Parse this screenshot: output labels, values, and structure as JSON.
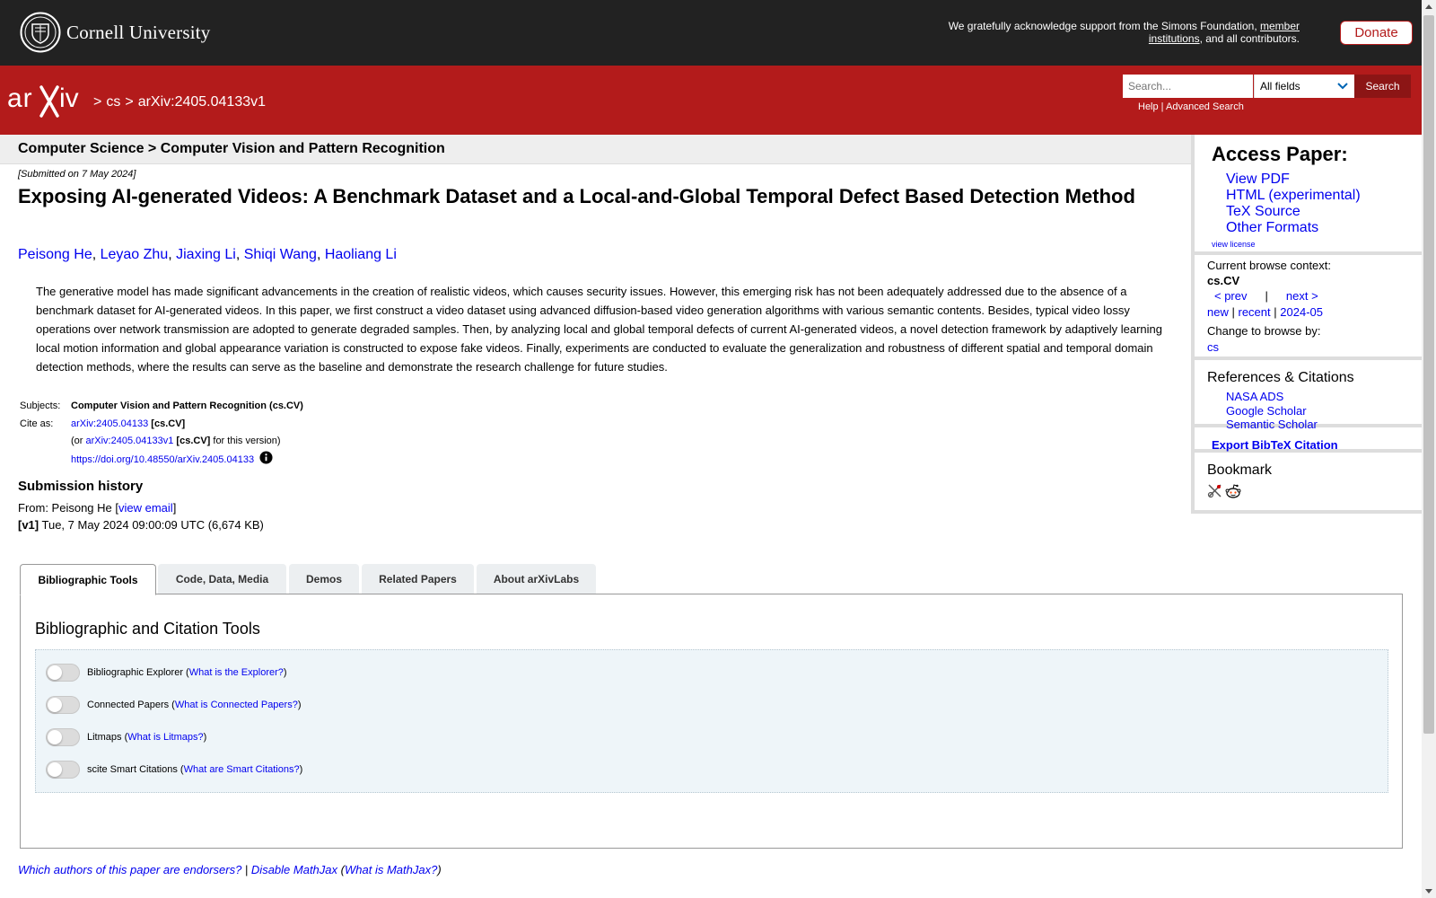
{
  "header": {
    "university": "Cornell University",
    "support_text_1": "We gratefully acknowledge support from the Simons Foundation, ",
    "support_link_1": "member institutions",
    "support_text_2": ", and all contributors.",
    "donate_label": "Donate"
  },
  "arxiv_bar": {
    "crumbs": [
      ">",
      "cs",
      ">",
      "arXiv:2405.04133v1"
    ],
    "search_placeholder": "Search...",
    "field_select": "All fields",
    "search_button": "Search",
    "help": "Help",
    "help_sep": " | ",
    "advanced_search": "Advanced Search"
  },
  "subheader": "Computer Science > Computer Vision and Pattern Recognition",
  "submitted": "[Submitted on 7 May 2024]",
  "title": "Exposing AI-generated Videos: A Benchmark Dataset and a Local-and-Global Temporal Defect Based Detection Method",
  "authors": [
    "Peisong He",
    "Leyao Zhu",
    "Jiaxing Li",
    "Shiqi Wang",
    "Haoliang Li"
  ],
  "abstract": "The generative model has made significant advancements in the creation of realistic videos, which causes security issues. However, this emerging risk has not been adequately addressed due to the absence of a benchmark dataset for AI-generated videos. In this paper, we first construct a video dataset using advanced diffusion-based video generation algorithms with various semantic contents. Besides, typical video lossy operations over network transmission are adopted to generate degraded samples. Then, by analyzing local and global temporal defects of current AI-generated videos, a novel detection framework by adaptively learning local motion information and global appearance variation is constructed to expose fake videos. Finally, experiments are conducted to evaluate the generalization and robustness of different spatial and temporal domain detection methods, where the results can serve as the baseline and demonstrate the research challenge for future studies.",
  "meta": {
    "subjects_label": "Subjects:",
    "subjects_value": "Computer Vision and Pattern Recognition (cs.CV)",
    "cite_label": "Cite as:",
    "cite_link": "arXiv:2405.04133",
    "cite_cat": "[cs.CV]",
    "or_open": "(or ",
    "version_link": "arXiv:2405.04133v1",
    "version_cat": "[cs.CV]",
    "version_suffix": " for this version)",
    "doi": "https://doi.org/10.48550/arXiv.2405.04133"
  },
  "history": {
    "heading": "Submission history",
    "from_prefix": "From: Peisong He [",
    "view_email": "view email",
    "from_suffix": "]",
    "v1_tag": "[v1]",
    "v1_text": " Tue, 7 May 2024 09:00:09 UTC (6,674 KB)"
  },
  "sidebar": {
    "access_heading": "Access Paper:",
    "access_links": [
      "View PDF",
      "HTML (experimental)",
      "TeX Source",
      "Other Formats"
    ],
    "view_license": "view license",
    "context_label": "Current browse context:",
    "context_value": "cs.CV",
    "prev": "< prev",
    "sep": "|",
    "next": "next >",
    "new": "new",
    "recent": "recent",
    "date": "2024-05",
    "change_label": "Change to browse by:",
    "change_value": "cs",
    "refs_heading": "References & Citations",
    "refs_links": [
      "NASA ADS",
      "Google Scholar",
      "Semantic Scholar"
    ],
    "bibtex": "Export BibTeX Citation",
    "bookmark_heading": "Bookmark"
  },
  "tabs": [
    "Bibliographic Tools",
    "Code, Data, Media",
    "Demos",
    "Related Papers",
    "About arXivLabs"
  ],
  "tools": {
    "heading": "Bibliographic and Citation Tools",
    "rows": [
      {
        "label": "Bibliographic Explorer",
        "link": "What is the Explorer?"
      },
      {
        "label": "Connected Papers",
        "link": "What is Connected Papers?"
      },
      {
        "label": "Litmaps",
        "link": "What is Litmaps?"
      },
      {
        "label": "scite Smart Citations",
        "link": "What are Smart Citations?"
      }
    ]
  },
  "footer": {
    "endorsers": "Which authors of this paper are endorsers?",
    "sep": " | ",
    "disable_mathjax": "Disable MathJax",
    "mathjax_open": " (",
    "what_mathjax": "What is MathJax?",
    "mathjax_close": ")"
  },
  "colors": {
    "arxiv_red": "#b31b1b",
    "cornell_bar": "#222222",
    "link_blue": "#0000ee"
  }
}
